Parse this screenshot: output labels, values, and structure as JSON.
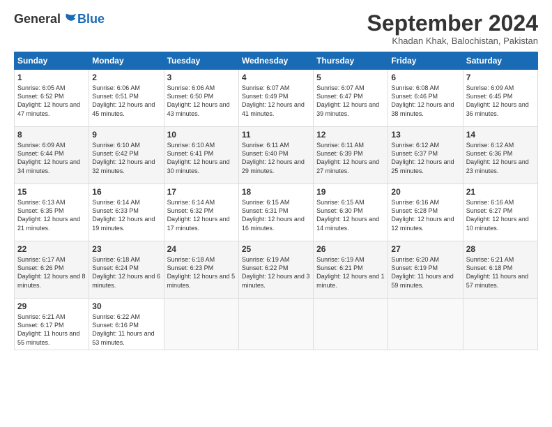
{
  "logo": {
    "general": "General",
    "blue": "Blue"
  },
  "title": "September 2024",
  "subtitle": "Khadan Khak, Balochistan, Pakistan",
  "headers": [
    "Sunday",
    "Monday",
    "Tuesday",
    "Wednesday",
    "Thursday",
    "Friday",
    "Saturday"
  ],
  "weeks": [
    [
      {
        "day": "1",
        "sunrise": "Sunrise: 6:05 AM",
        "sunset": "Sunset: 6:52 PM",
        "daylight": "Daylight: 12 hours and 47 minutes."
      },
      {
        "day": "2",
        "sunrise": "Sunrise: 6:06 AM",
        "sunset": "Sunset: 6:51 PM",
        "daylight": "Daylight: 12 hours and 45 minutes."
      },
      {
        "day": "3",
        "sunrise": "Sunrise: 6:06 AM",
        "sunset": "Sunset: 6:50 PM",
        "daylight": "Daylight: 12 hours and 43 minutes."
      },
      {
        "day": "4",
        "sunrise": "Sunrise: 6:07 AM",
        "sunset": "Sunset: 6:49 PM",
        "daylight": "Daylight: 12 hours and 41 minutes."
      },
      {
        "day": "5",
        "sunrise": "Sunrise: 6:07 AM",
        "sunset": "Sunset: 6:47 PM",
        "daylight": "Daylight: 12 hours and 39 minutes."
      },
      {
        "day": "6",
        "sunrise": "Sunrise: 6:08 AM",
        "sunset": "Sunset: 6:46 PM",
        "daylight": "Daylight: 12 hours and 38 minutes."
      },
      {
        "day": "7",
        "sunrise": "Sunrise: 6:09 AM",
        "sunset": "Sunset: 6:45 PM",
        "daylight": "Daylight: 12 hours and 36 minutes."
      }
    ],
    [
      {
        "day": "8",
        "sunrise": "Sunrise: 6:09 AM",
        "sunset": "Sunset: 6:44 PM",
        "daylight": "Daylight: 12 hours and 34 minutes."
      },
      {
        "day": "9",
        "sunrise": "Sunrise: 6:10 AM",
        "sunset": "Sunset: 6:42 PM",
        "daylight": "Daylight: 12 hours and 32 minutes."
      },
      {
        "day": "10",
        "sunrise": "Sunrise: 6:10 AM",
        "sunset": "Sunset: 6:41 PM",
        "daylight": "Daylight: 12 hours and 30 minutes."
      },
      {
        "day": "11",
        "sunrise": "Sunrise: 6:11 AM",
        "sunset": "Sunset: 6:40 PM",
        "daylight": "Daylight: 12 hours and 29 minutes."
      },
      {
        "day": "12",
        "sunrise": "Sunrise: 6:11 AM",
        "sunset": "Sunset: 6:39 PM",
        "daylight": "Daylight: 12 hours and 27 minutes."
      },
      {
        "day": "13",
        "sunrise": "Sunrise: 6:12 AM",
        "sunset": "Sunset: 6:37 PM",
        "daylight": "Daylight: 12 hours and 25 minutes."
      },
      {
        "day": "14",
        "sunrise": "Sunrise: 6:12 AM",
        "sunset": "Sunset: 6:36 PM",
        "daylight": "Daylight: 12 hours and 23 minutes."
      }
    ],
    [
      {
        "day": "15",
        "sunrise": "Sunrise: 6:13 AM",
        "sunset": "Sunset: 6:35 PM",
        "daylight": "Daylight: 12 hours and 21 minutes."
      },
      {
        "day": "16",
        "sunrise": "Sunrise: 6:14 AM",
        "sunset": "Sunset: 6:33 PM",
        "daylight": "Daylight: 12 hours and 19 minutes."
      },
      {
        "day": "17",
        "sunrise": "Sunrise: 6:14 AM",
        "sunset": "Sunset: 6:32 PM",
        "daylight": "Daylight: 12 hours and 17 minutes."
      },
      {
        "day": "18",
        "sunrise": "Sunrise: 6:15 AM",
        "sunset": "Sunset: 6:31 PM",
        "daylight": "Daylight: 12 hours and 16 minutes."
      },
      {
        "day": "19",
        "sunrise": "Sunrise: 6:15 AM",
        "sunset": "Sunset: 6:30 PM",
        "daylight": "Daylight: 12 hours and 14 minutes."
      },
      {
        "day": "20",
        "sunrise": "Sunrise: 6:16 AM",
        "sunset": "Sunset: 6:28 PM",
        "daylight": "Daylight: 12 hours and 12 minutes."
      },
      {
        "day": "21",
        "sunrise": "Sunrise: 6:16 AM",
        "sunset": "Sunset: 6:27 PM",
        "daylight": "Daylight: 12 hours and 10 minutes."
      }
    ],
    [
      {
        "day": "22",
        "sunrise": "Sunrise: 6:17 AM",
        "sunset": "Sunset: 6:26 PM",
        "daylight": "Daylight: 12 hours and 8 minutes."
      },
      {
        "day": "23",
        "sunrise": "Sunrise: 6:18 AM",
        "sunset": "Sunset: 6:24 PM",
        "daylight": "Daylight: 12 hours and 6 minutes."
      },
      {
        "day": "24",
        "sunrise": "Sunrise: 6:18 AM",
        "sunset": "Sunset: 6:23 PM",
        "daylight": "Daylight: 12 hours and 5 minutes."
      },
      {
        "day": "25",
        "sunrise": "Sunrise: 6:19 AM",
        "sunset": "Sunset: 6:22 PM",
        "daylight": "Daylight: 12 hours and 3 minutes."
      },
      {
        "day": "26",
        "sunrise": "Sunrise: 6:19 AM",
        "sunset": "Sunset: 6:21 PM",
        "daylight": "Daylight: 12 hours and 1 minute."
      },
      {
        "day": "27",
        "sunrise": "Sunrise: 6:20 AM",
        "sunset": "Sunset: 6:19 PM",
        "daylight": "Daylight: 11 hours and 59 minutes."
      },
      {
        "day": "28",
        "sunrise": "Sunrise: 6:21 AM",
        "sunset": "Sunset: 6:18 PM",
        "daylight": "Daylight: 11 hours and 57 minutes."
      }
    ],
    [
      {
        "day": "29",
        "sunrise": "Sunrise: 6:21 AM",
        "sunset": "Sunset: 6:17 PM",
        "daylight": "Daylight: 11 hours and 55 minutes."
      },
      {
        "day": "30",
        "sunrise": "Sunrise: 6:22 AM",
        "sunset": "Sunset: 6:16 PM",
        "daylight": "Daylight: 11 hours and 53 minutes."
      },
      null,
      null,
      null,
      null,
      null
    ]
  ]
}
